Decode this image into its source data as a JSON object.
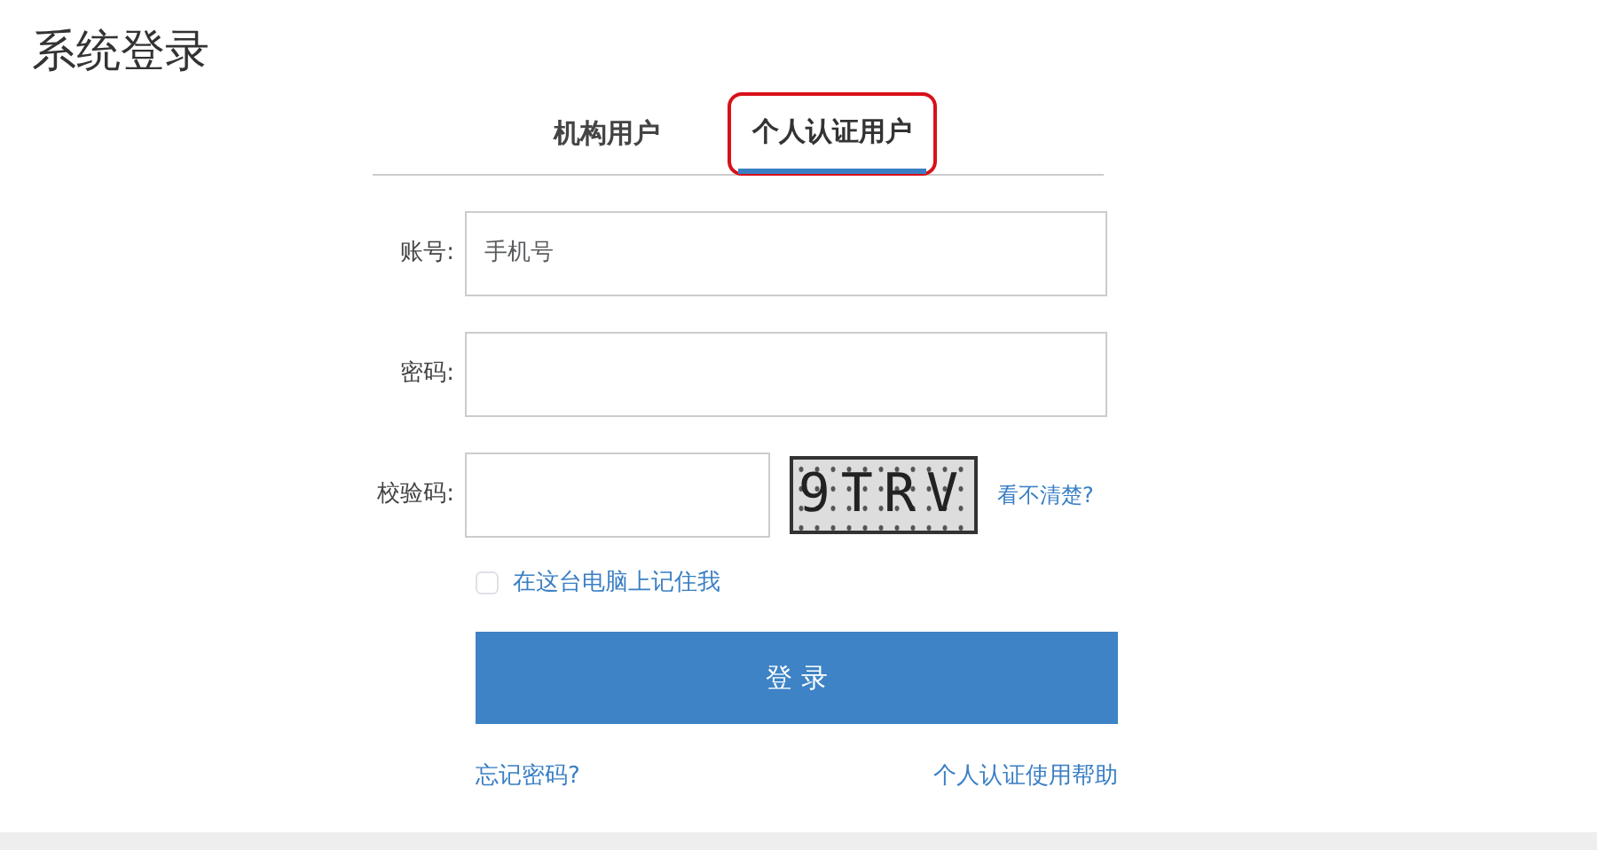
{
  "title": "系统登录",
  "tabs": [
    {
      "label": "机构用户",
      "selected": false,
      "highlighted": false
    },
    {
      "label": "个人认证用户",
      "selected": true,
      "highlighted": true
    }
  ],
  "fields": [
    {
      "label": "账号:",
      "placeholder": "手机号"
    },
    {
      "label": "密码:"
    }
  ],
  "captcha": {
    "label": "校验码:",
    "code": "9TRV",
    "refresh": "看不清楚?"
  },
  "remember": {
    "label": "在这台电脑上记住我",
    "checked": false
  },
  "submit": "登 录",
  "links": [
    "忘记密码?",
    "个人认证使用帮助"
  ]
}
